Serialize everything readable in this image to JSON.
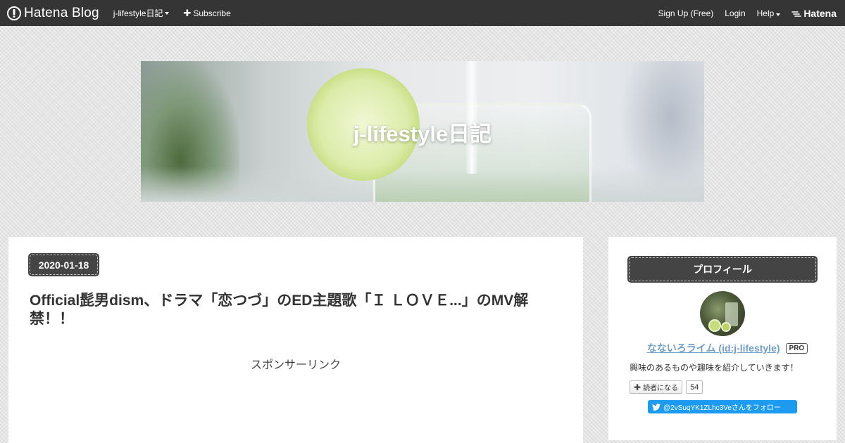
{
  "globalheader": {
    "logo": "Hatena Blog",
    "blog_menu": "j-lifestyle日記",
    "subscribe": "Subscribe",
    "signup": "Sign Up (Free)",
    "login": "Login",
    "help": "Help",
    "brand": "Hatena"
  },
  "header": {
    "title": "j-lifestyle日記"
  },
  "entry": {
    "date": "2020-01-18",
    "title": "Official髭男dism、ドラマ「恋つづ」のED主題歌「Ｉ ＬＯＶＥ...」のMV解禁！！",
    "sponsor_label": "スポンサーリンク"
  },
  "sidebar": {
    "module_title": "プロフィール",
    "profile_name": "なないろライム (id:j-lifestyle)",
    "pro_badge": "PRO",
    "description": "興味のあるものや趣味を紹介していきます！",
    "subscribe_label": "読者になる",
    "subscriber_count": "54",
    "twitter_follow": "@2vSuqYK1ZLhc3Veさんをフォロー"
  },
  "colors": {
    "topbar": "#353535",
    "badge_bg": "#444444",
    "link": "#6f9fc8",
    "twitter": "#1d9bf0"
  }
}
